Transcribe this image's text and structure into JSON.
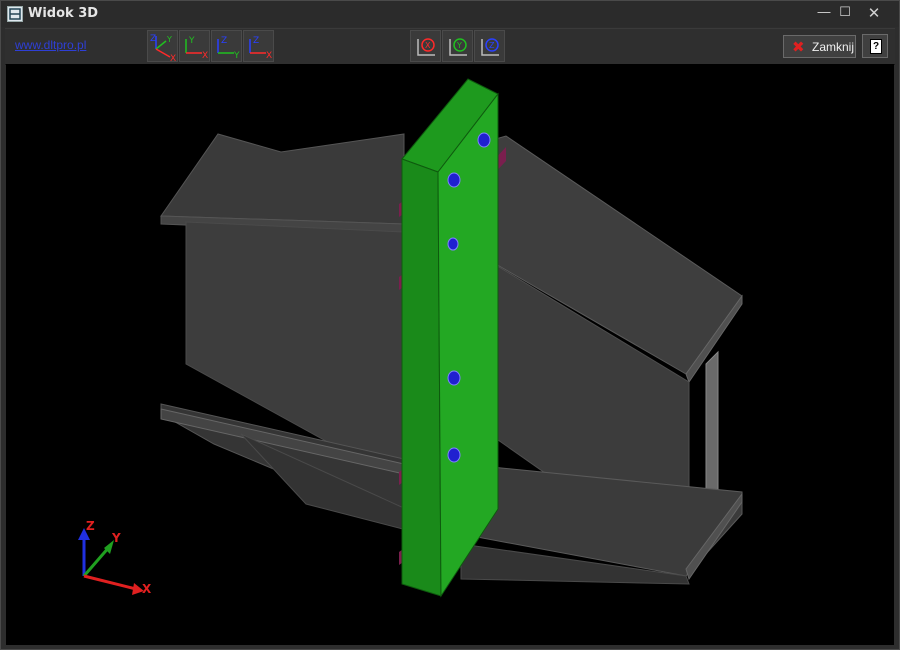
{
  "window": {
    "title": "Widok 3D"
  },
  "toolbar": {
    "link_text": "www.dltpro.pl",
    "view_buttons": [
      {
        "name": "view-iso-button",
        "labels": [
          "Z",
          "Y",
          "X"
        ]
      },
      {
        "name": "view-xy-button",
        "labels": [
          "Y",
          "X"
        ]
      },
      {
        "name": "view-zy-button",
        "labels": [
          "Z",
          "Y"
        ]
      },
      {
        "name": "view-zx-button",
        "labels": [
          "Z",
          "X"
        ]
      }
    ],
    "rotate_buttons": [
      {
        "name": "rotate-x-button",
        "label": "X"
      },
      {
        "name": "rotate-y-button",
        "label": "Y"
      },
      {
        "name": "rotate-z-button",
        "label": "Z"
      }
    ],
    "close_label": "Zamknij",
    "help_label": "?"
  },
  "axes": {
    "x": "X",
    "y": "Y",
    "z": "Z"
  },
  "colors": {
    "background": "#000000",
    "beam": "#3c3c3c",
    "plate": "#1a8a1a",
    "stiffener": "#7a1f4e",
    "bolt": "#2020d0",
    "axis_x": "#e02020",
    "axis_y": "#20a020",
    "axis_z": "#2030e0"
  }
}
